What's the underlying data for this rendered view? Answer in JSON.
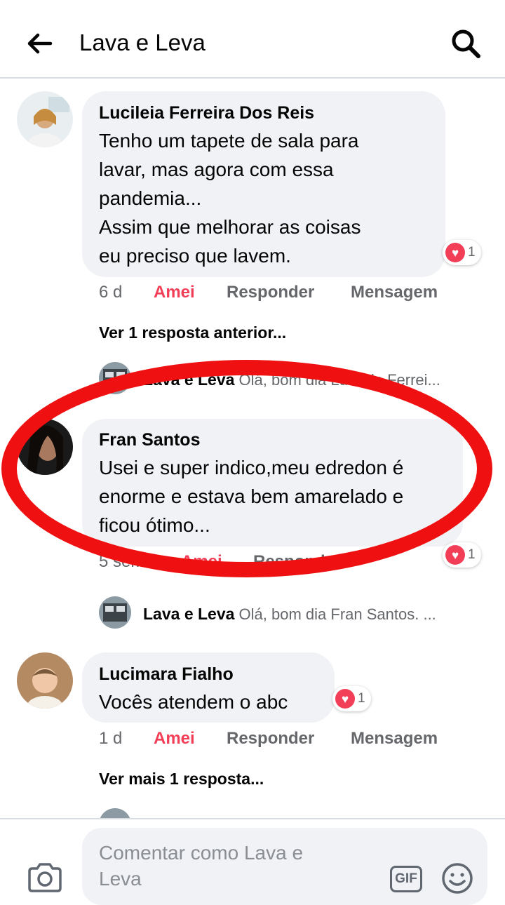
{
  "header": {
    "title": "Lava e Leva"
  },
  "comments": [
    {
      "author": "Lucileia Ferreira Dos Reis",
      "lines": [
        "Tenho  um tapete  de sala para",
        "lavar, mas agora  com essa",
        "pandemia...",
        "Assim que  melhorar  as coisas",
        "eu preciso  que lavem."
      ],
      "reaction_count": "1",
      "time": "6 d",
      "love_label": "Amei",
      "reply_label": "Responder",
      "message_label": "Mensagem"
    },
    {
      "author": "Fran Santos",
      "lines": [
        "Usei e super indico,meu edredon é",
        "enorme e estava bem amarelado e",
        "ficou ótimo..."
      ],
      "reaction_count": "1",
      "time": "5 sem",
      "love_label": "Amei",
      "reply_label": "Responder"
    },
    {
      "author": "Lucimara Fialho",
      "lines": [
        "Vocês atendem o abc"
      ],
      "reaction_count": "1",
      "time": "1 d",
      "love_label": "Amei",
      "reply_label": "Responder",
      "message_label": "Mensagem"
    }
  ],
  "previous_replies_link": "Ver 1 resposta anterior...",
  "more_replies_link": "Ver mais 1 resposta...",
  "replies": [
    {
      "author": "Lava e Leva",
      "text": "Olá, bom dia Lucileia Ferrei..."
    },
    {
      "author": "Lava e Leva",
      "text": "Olá, bom dia Fran Santos. ..."
    }
  ],
  "composer": {
    "placeholder_line1": "Comentar como Lava e",
    "placeholder_line2": "Leva",
    "gif_label": "GIF"
  },
  "colors": {
    "love": "#f33e58",
    "highlight_oval": "#ef1111",
    "bubble": "#f0f2f5"
  },
  "icons": [
    "back-arrow-icon",
    "search-icon",
    "heart-icon",
    "camera-icon",
    "gif-icon",
    "emoji-icon"
  ]
}
